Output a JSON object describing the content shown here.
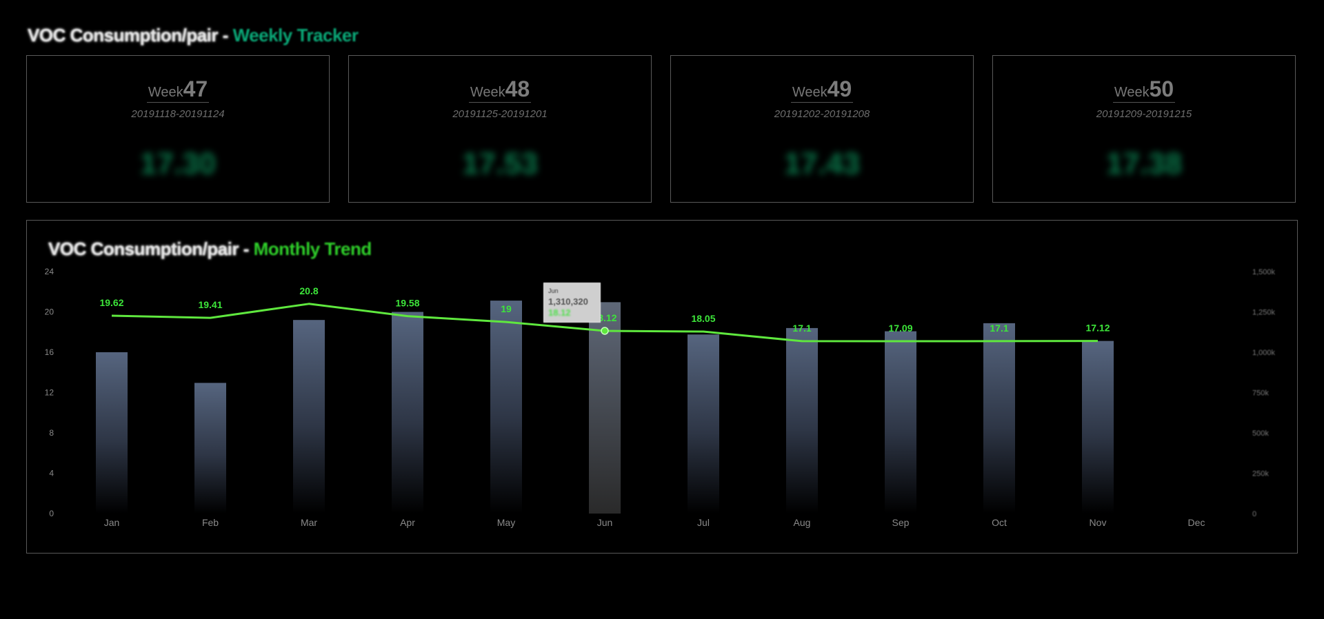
{
  "weekly": {
    "title_main": "VOC Consumption/pair - ",
    "title_accent": "Weekly Tracker",
    "cards": [
      {
        "week_label": "Week",
        "week_number": "47",
        "range": "20191118-20191124",
        "value": "17.30"
      },
      {
        "week_label": "Week",
        "week_number": "48",
        "range": "20191125-20191201",
        "value": "17.53"
      },
      {
        "week_label": "Week",
        "week_number": "49",
        "range": "20191202-20191208",
        "value": "17.43"
      },
      {
        "week_label": "Week",
        "week_number": "50",
        "range": "20191209-20191215",
        "value": "17.38"
      }
    ]
  },
  "monthly": {
    "title_main": "VOC Consumption/pair - ",
    "title_accent": "Monthly Trend"
  },
  "tooltip": {
    "month": "Jun",
    "volume": "1,310,320",
    "ratio": "18.12"
  },
  "colors": {
    "accent_weekly": "#0aa978",
    "accent_monthly": "#2fd02a",
    "line": "#5fe83e",
    "bar_top": "#56657f",
    "bar_bottom": "#000000",
    "bar_highlight": "#3a3a3a"
  },
  "chart_data": {
    "type": "bar",
    "categories": [
      "Jan",
      "Feb",
      "Mar",
      "Apr",
      "May",
      "Jun",
      "Jul",
      "Aug",
      "Sep",
      "Oct",
      "Nov",
      "Dec"
    ],
    "series": [
      {
        "type": "bar",
        "axis": "right",
        "values": [
          1000000,
          810000,
          1200000,
          1250000,
          1320000,
          1310320,
          1110000,
          1150000,
          1130000,
          1180000,
          1070000,
          null
        ]
      },
      {
        "type": "line",
        "axis": "left",
        "values": [
          19.62,
          19.41,
          20.8,
          19.58,
          19.0,
          18.12,
          18.05,
          17.1,
          17.09,
          17.1,
          17.12,
          null
        ]
      }
    ],
    "data_labels": [
      "19.62",
      "19.41",
      "20.8",
      "19.58",
      "19",
      "18.12",
      "18.05",
      "17.1",
      "17.09",
      "17.1",
      "17.12",
      ""
    ],
    "y_left": {
      "ticks": [
        "0",
        "4",
        "8",
        "12",
        "16",
        "20",
        "24"
      ],
      "ylim": [
        0,
        24
      ]
    },
    "y_right": {
      "ticks": [
        "0",
        "250k",
        "500k",
        "750k",
        "1,000k",
        "1,250k",
        "1,500k"
      ],
      "ylim": [
        0,
        1500000
      ]
    },
    "highlight_index": 5,
    "grid": false
  }
}
